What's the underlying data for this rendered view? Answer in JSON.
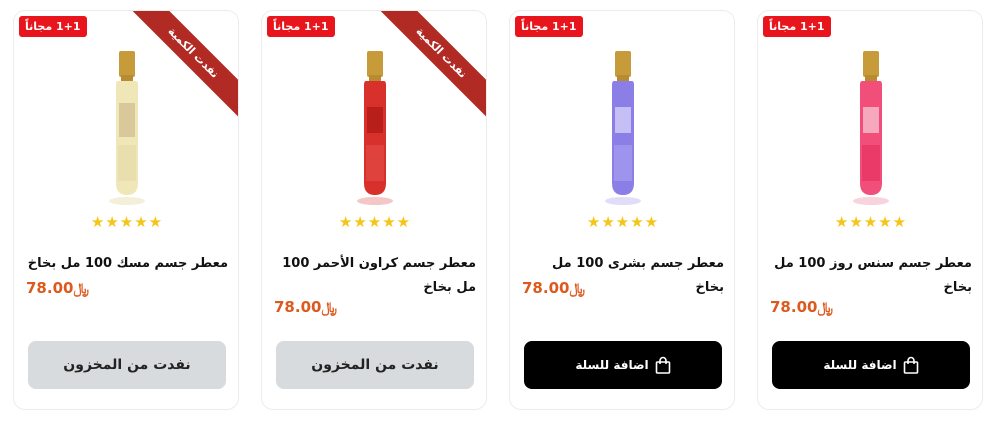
{
  "colors": {
    "badge": "#e8151c",
    "ribbon": "#b22a24",
    "price": "#dd5a1f",
    "star": "#f5c518",
    "add_button": "#000000",
    "out_button": "#d8dbdd"
  },
  "products": [
    {
      "badge": "1+1 مجاناً",
      "ribbon": "",
      "rating": 5,
      "title": "معطر جسم سنس روز 100 مل بخاخ",
      "price": "78.00",
      "currency": "﷼",
      "button": "اضافة للسلة",
      "button_icon": "shopping-bag-icon",
      "in_stock": true
    },
    {
      "badge": "1+1 مجاناً",
      "ribbon": "",
      "rating": 5,
      "title": "معطر جسم بشرى 100 مل بخاخ",
      "price": "78.00",
      "currency": "﷼",
      "button": "اضافة للسلة",
      "button_icon": "shopping-bag-icon",
      "in_stock": true
    },
    {
      "badge": "1+1 مجاناً",
      "ribbon": "نفدت الكمية",
      "rating": 5,
      "title": "معطر جسم كراون الأحمر 100 مل بخاخ",
      "price": "78.00",
      "currency": "﷼",
      "button": "نفدت من المخزون",
      "in_stock": false
    },
    {
      "badge": "1+1 مجاناً",
      "ribbon": "نفدت الكمية",
      "rating": 5,
      "title": "معطر جسم مسك 100 مل بخاخ",
      "price": "78.00",
      "currency": "﷼",
      "button": "نفدت من المخزون",
      "in_stock": false
    }
  ]
}
